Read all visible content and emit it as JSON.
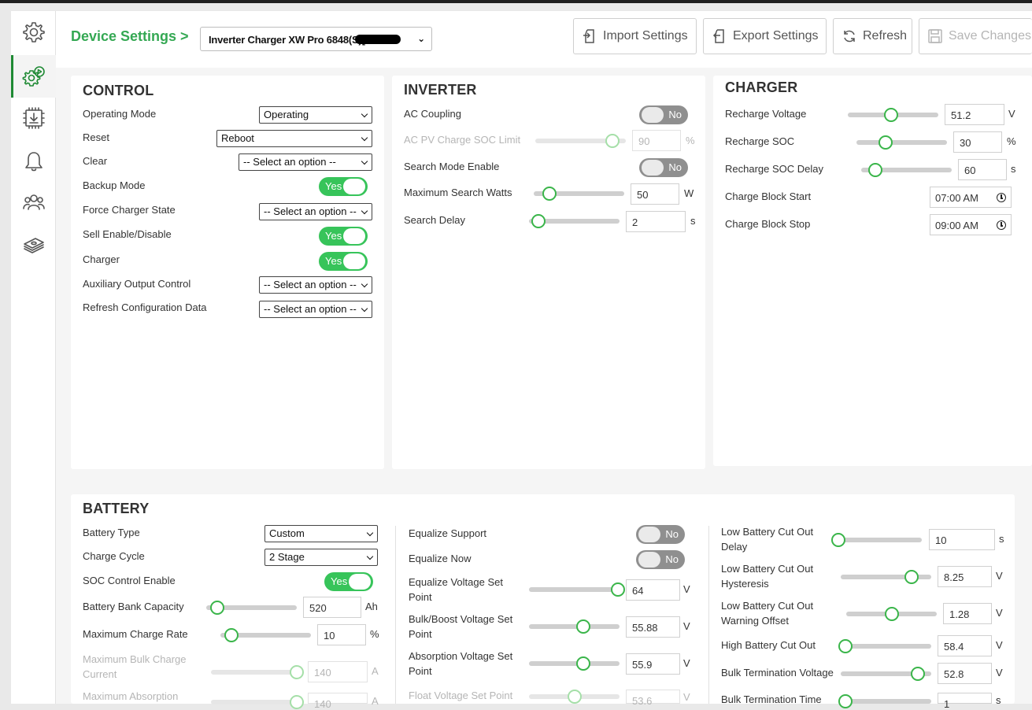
{
  "header": {
    "breadcrumb": "Device Settings >",
    "device": "Inverter Charger XW Pro 6848(S)[",
    "buttons": {
      "import": "Import Settings",
      "export": "Export Settings",
      "refresh": "Refresh",
      "save": "Save Changes"
    }
  },
  "sidebar": {
    "items": [
      {
        "icon": "gear-icon"
      },
      {
        "icon": "device-settings-icon"
      },
      {
        "icon": "firmware-download-icon"
      },
      {
        "icon": "bell-icon"
      },
      {
        "icon": "users-icon"
      },
      {
        "icon": "money-icon"
      }
    ]
  },
  "control": {
    "title": "CONTROL",
    "operating_mode": {
      "label": "Operating Mode",
      "value": "Operating"
    },
    "reset": {
      "label": "Reset",
      "value": "Reboot"
    },
    "clear": {
      "label": "Clear",
      "value": "-- Select an option --"
    },
    "backup_mode": {
      "label": "Backup Mode",
      "value": "Yes"
    },
    "force_charger_state": {
      "label": "Force Charger State",
      "value": "-- Select an option --"
    },
    "sell_enable": {
      "label": "Sell Enable/Disable",
      "value": "Yes"
    },
    "charger": {
      "label": "Charger",
      "value": "Yes"
    },
    "aux_output": {
      "label": "Auxiliary Output Control",
      "value": "-- Select an option --"
    },
    "refresh_config": {
      "label": "Refresh Configuration Data",
      "value": "-- Select an option --"
    }
  },
  "inverter": {
    "title": "INVERTER",
    "ac_coupling": {
      "label": "AC Coupling",
      "value": "No"
    },
    "ac_pv_soc_limit": {
      "label": "AC PV Charge SOC Limit",
      "value": "90",
      "unit": "%",
      "level": 0.85
    },
    "search_mode": {
      "label": "Search Mode Enable",
      "value": "No"
    },
    "max_search_watts": {
      "label": "Maximum Search Watts",
      "value": "50",
      "unit": "W",
      "level": 0.17
    },
    "search_delay": {
      "label": "Search Delay",
      "value": "2",
      "unit": "s",
      "level": 0.1
    }
  },
  "charger_panel": {
    "title": "CHARGER",
    "recharge_voltage": {
      "label": "Recharge Voltage",
      "value": "51.2",
      "unit": "V",
      "level": 0.48
    },
    "recharge_soc": {
      "label": "Recharge SOC",
      "value": "30",
      "unit": "%",
      "level": 0.32
    },
    "recharge_soc_delay": {
      "label": "Recharge SOC Delay",
      "value": "60",
      "unit": "s",
      "level": 0.16
    },
    "charge_block_start": {
      "label": "Charge Block Start",
      "value": "07:00 AM"
    },
    "charge_block_stop": {
      "label": "Charge Block Stop",
      "value": "09:00 AM"
    }
  },
  "battery": {
    "title": "BATTERY",
    "col1": {
      "battery_type": {
        "label": "Battery Type",
        "value": "Custom"
      },
      "charge_cycle": {
        "label": "Charge Cycle",
        "value": "2 Stage"
      },
      "soc_control": {
        "label": "SOC Control Enable",
        "value": "Yes"
      },
      "bank_capacity": {
        "label": "Battery Bank Capacity",
        "value": "520",
        "unit": "Ah",
        "level": 0.12
      },
      "max_charge_rate": {
        "label": "Maximum Charge Rate",
        "value": "10",
        "unit": "%",
        "level": 0.12
      },
      "max_bulk_current": {
        "label": "Maximum Bulk Charge Current",
        "value": "140",
        "unit": "A",
        "level": 0.95
      },
      "max_absorption": {
        "label": "Maximum Absorption",
        "value": "140",
        "unit": "A",
        "level": 0.95
      }
    },
    "col2": {
      "equalize_support": {
        "label": "Equalize Support",
        "value": "No"
      },
      "equalize_now": {
        "label": "Equalize Now",
        "value": "No"
      },
      "equalize_voltage": {
        "label": "Equalize Voltage Set Point",
        "value": "64",
        "unit": "V",
        "level": 0.98
      },
      "bulk_boost_voltage": {
        "label": "Bulk/Boost Voltage Set Point",
        "value": "55.88",
        "unit": "V",
        "level": 0.6
      },
      "absorption_voltage": {
        "label": "Absorption Voltage Set Point",
        "value": "55.9",
        "unit": "V",
        "level": 0.6
      },
      "float_voltage": {
        "label": "Float Voltage Set Point",
        "value": "53.6",
        "unit": "V",
        "level": 0.5
      }
    },
    "col3": {
      "low_batt_cutout_delay": {
        "label": "Low Battery Cut Out Delay",
        "value": "10",
        "unit": "s",
        "level": 0.05
      },
      "low_batt_cutout_hysteresis": {
        "label": "Low Battery Cut Out Hysteresis",
        "value": "8.25",
        "unit": "V",
        "level": 0.78
      },
      "low_batt_warning_offset": {
        "label": "Low Battery Cut Out Warning Offset",
        "value": "1.28",
        "unit": "V",
        "level": 0.5
      },
      "high_batt_cutout": {
        "label": "High Battery Cut Out",
        "value": "58.4",
        "unit": "V",
        "level": 0.05
      },
      "bulk_termination_voltage": {
        "label": "Bulk Termination Voltage",
        "value": "52.8",
        "unit": "V",
        "level": 0.85
      },
      "bulk_termination_time": {
        "label": "Bulk Termination Time",
        "value": "1",
        "unit": "s",
        "level": 0.05
      }
    }
  }
}
